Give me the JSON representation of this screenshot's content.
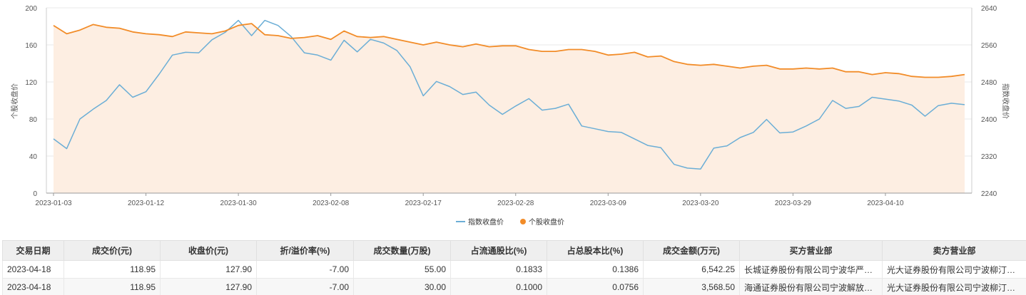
{
  "chart_data": {
    "type": "line",
    "x_tick_labels": [
      "2023-01-03",
      "2023-01-12",
      "2023-01-30",
      "2023-02-08",
      "2023-02-17",
      "2023-02-28",
      "2023-03-09",
      "2023-03-20",
      "2023-03-29",
      "2023-04-10"
    ],
    "x_tick_index": [
      0,
      7,
      14,
      21,
      28,
      35,
      42,
      49,
      56,
      63
    ],
    "n_points": 70,
    "y_left": {
      "label": "个股收盘价",
      "min": 0,
      "max": 200,
      "ticks": [
        0,
        40,
        80,
        120,
        160,
        200
      ]
    },
    "y_right": {
      "label": "指数收盘价",
      "min": 2240,
      "max": 2640,
      "ticks": [
        2240,
        2320,
        2400,
        2480,
        2560,
        2640
      ]
    },
    "series": [
      {
        "name": "指数收盘价",
        "axis": "right",
        "color": "#6baed6",
        "values": [
          2357,
          2336,
          2400,
          2421,
          2440,
          2474,
          2447,
          2459,
          2497,
          2538,
          2544,
          2543,
          2571,
          2587,
          2613,
          2580,
          2613,
          2602,
          2578,
          2543,
          2538,
          2527,
          2570,
          2545,
          2572,
          2564,
          2548,
          2513,
          2450,
          2481,
          2470,
          2453,
          2458,
          2430,
          2410,
          2428,
          2444,
          2419,
          2423,
          2432,
          2385,
          2379,
          2373,
          2371,
          2357,
          2343,
          2338,
          2302,
          2294,
          2292,
          2337,
          2342,
          2360,
          2371,
          2399,
          2370,
          2372,
          2385,
          2400,
          2440,
          2423,
          2427,
          2447,
          2443,
          2439,
          2430,
          2406,
          2429,
          2434,
          2431
        ]
      },
      {
        "name": "个股收盘价",
        "axis": "left",
        "color": "#f28c28",
        "values": [
          181,
          172,
          176,
          182,
          179,
          178,
          174,
          172,
          171,
          169,
          174,
          173,
          172,
          175,
          181,
          183,
          171,
          170,
          167,
          168,
          170,
          166,
          175,
          169,
          168,
          169,
          166,
          163,
          160,
          163,
          160,
          158,
          161,
          158,
          159,
          159,
          155,
          153,
          153,
          155,
          155,
          153,
          149,
          150,
          152,
          147,
          148,
          142,
          139,
          138,
          139,
          137,
          135,
          137,
          138,
          134,
          134,
          135,
          134,
          135,
          131,
          131,
          128,
          130,
          129,
          126,
          125,
          125,
          126,
          128
        ]
      }
    ],
    "area_fill": "#fdeee2",
    "grid": true
  },
  "legend": {
    "index_label": "指数收盘价",
    "stock_label": "个股收盘价"
  },
  "table": {
    "headers": [
      "交易日期",
      "成交价(元)",
      "收盘价(元)",
      "折/溢价率(%)",
      "成交数量(万股)",
      "占流通股比(%)",
      "占总股本比(%)",
      "成交金额(万元)",
      "买方营业部",
      "卖方营业部"
    ],
    "rows": [
      [
        "2023-04-18",
        "118.95",
        "127.90",
        "-7.00",
        "55.00",
        "0.1833",
        "0.1386",
        "6,542.25",
        "长城证券股份有限公司宁波华严街…",
        "光大证券股份有限公司宁波柳汀街…"
      ],
      [
        "2023-04-18",
        "118.95",
        "127.90",
        "-7.00",
        "30.00",
        "0.1000",
        "0.0756",
        "3,568.50",
        "海通证券股份有限公司宁波解放北…",
        "光大证券股份有限公司宁波柳汀街…"
      ]
    ]
  }
}
